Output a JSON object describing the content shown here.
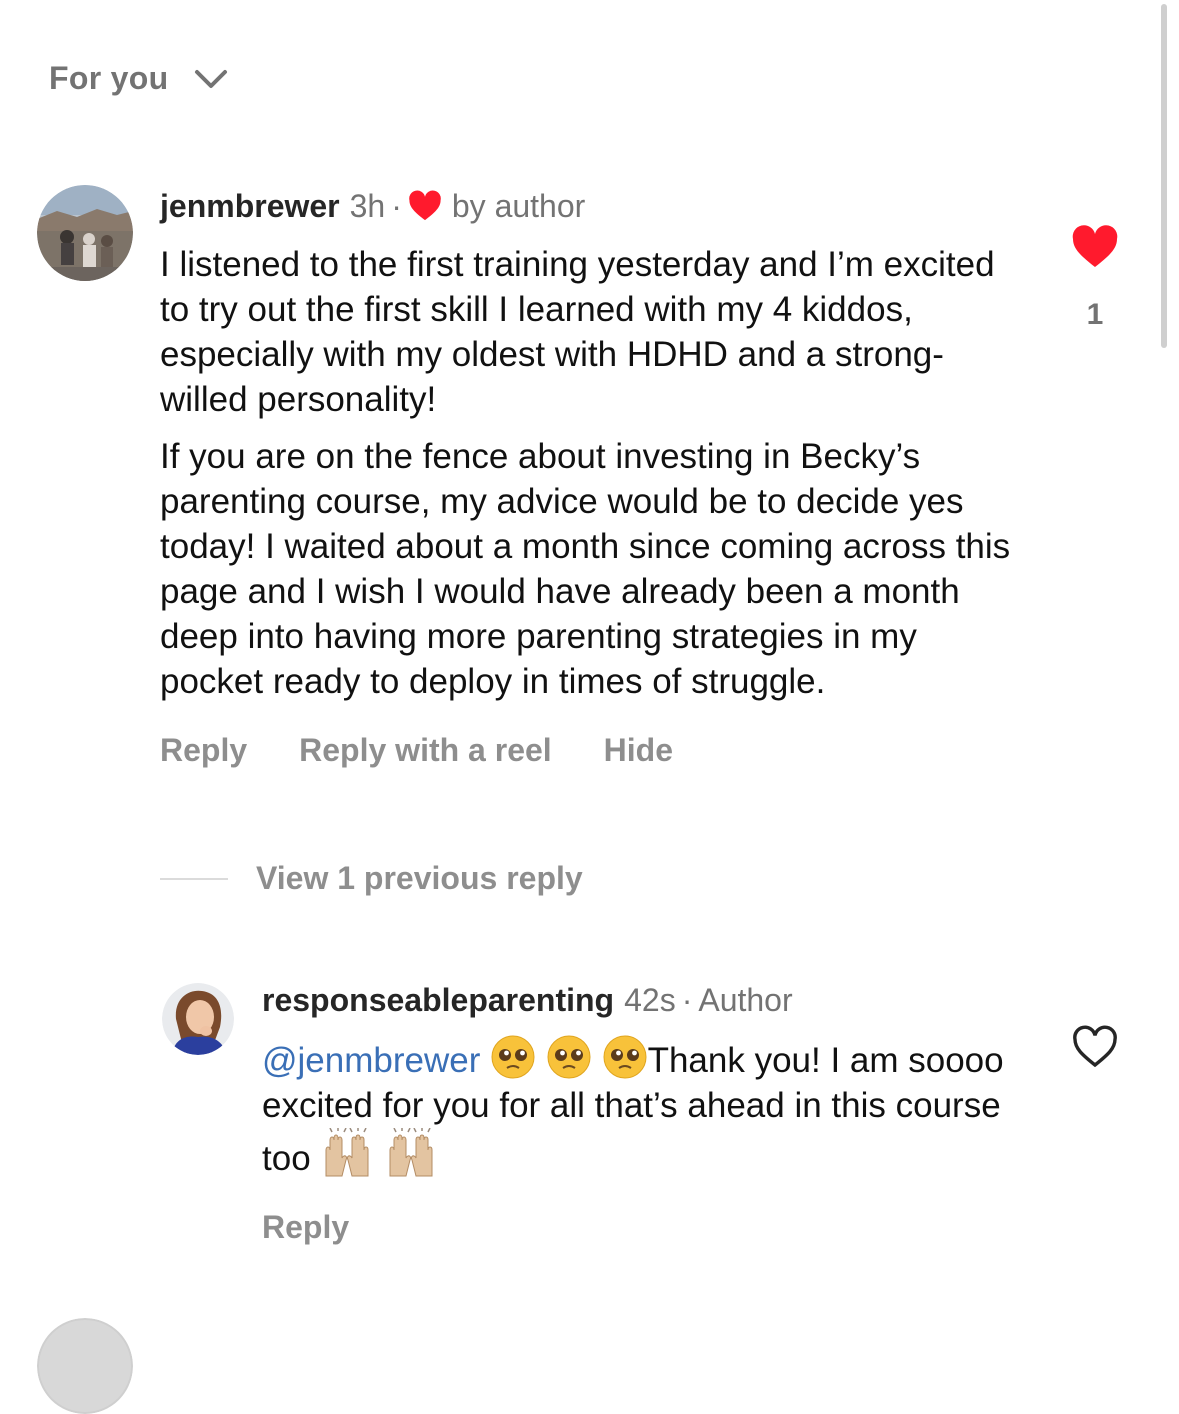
{
  "header": {
    "filter_label": "For you",
    "chevron_icon": "chevron-down-icon"
  },
  "comment": {
    "username": "jenmbrewer",
    "time": "3h",
    "separator": "·",
    "liked_by_author_label": "by author",
    "paragraphs": [
      "I listened to the first training yesterday and I’m excited to try out the first skill I learned with my 4 kiddos, especially with my oldest with HDHD and a strong-willed personality!",
      "If you are on the fence about investing in Becky’s parenting course, my advice would be to decide yes today! I waited about a month since coming across this page and I wish I would have already been a month deep into having more parenting strategies in my pocket ready to deploy in times of struggle."
    ],
    "actions": {
      "reply": "Reply",
      "reply_reel": "Reply with a reel",
      "hide": "Hide"
    },
    "like_count": "1",
    "liked": true,
    "heart_color": "#ff1a2d"
  },
  "replies_toggle": {
    "label": "View 1 previous reply"
  },
  "reply": {
    "username": "responseableparenting",
    "time": "42s",
    "separator": "·",
    "author_tag": "Author",
    "mention": "@jenmbrewer",
    "emoji_before": [
      "pleading-face",
      "pleading-face",
      "pleading-face"
    ],
    "text": "Thank you! I am soooo excited for you for all that’s ahead in this course too",
    "emoji_after": [
      "raising-hands",
      "raising-hands"
    ],
    "actions": {
      "reply": "Reply"
    },
    "liked": false
  },
  "colors": {
    "accent_link": "#3a6fb6",
    "muted_text": "#737373",
    "action_text": "#8e8e8e",
    "text": "#111111"
  }
}
